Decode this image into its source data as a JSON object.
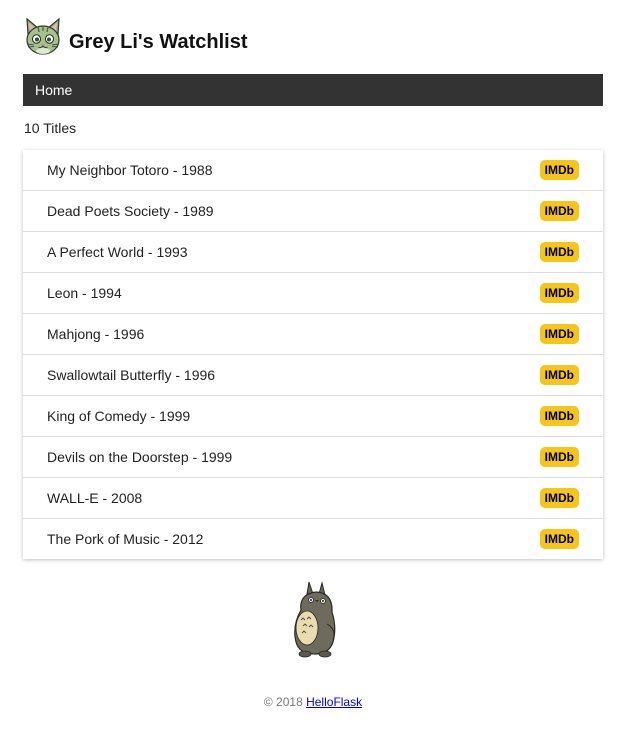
{
  "header": {
    "title": "Grey Li's Watchlist",
    "avatar_icon": "cat-avatar-icon"
  },
  "nav": {
    "items": [
      {
        "label": "Home"
      }
    ]
  },
  "count_text": "10 Titles",
  "movies": [
    {
      "label": "My Neighbor Totoro - 1988",
      "badge": "IMDb"
    },
    {
      "label": "Dead Poets Society - 1989",
      "badge": "IMDb"
    },
    {
      "label": "A Perfect World - 1993",
      "badge": "IMDb"
    },
    {
      "label": "Leon - 1994",
      "badge": "IMDb"
    },
    {
      "label": "Mahjong - 1996",
      "badge": "IMDb"
    },
    {
      "label": "Swallowtail Butterfly - 1996",
      "badge": "IMDb"
    },
    {
      "label": "King of Comedy - 1999",
      "badge": "IMDb"
    },
    {
      "label": "Devils on the Doorstep - 1999",
      "badge": "IMDb"
    },
    {
      "label": "WALL-E - 2008",
      "badge": "IMDb"
    },
    {
      "label": "The Pork of Music - 2012",
      "badge": "IMDb"
    }
  ],
  "footer": {
    "copyright": "© 2018 ",
    "link_text": "HelloFlask"
  },
  "colors": {
    "navbar": "#333333",
    "imdb_badge": "#f5c518"
  },
  "illustration_icon": "totoro-icon"
}
